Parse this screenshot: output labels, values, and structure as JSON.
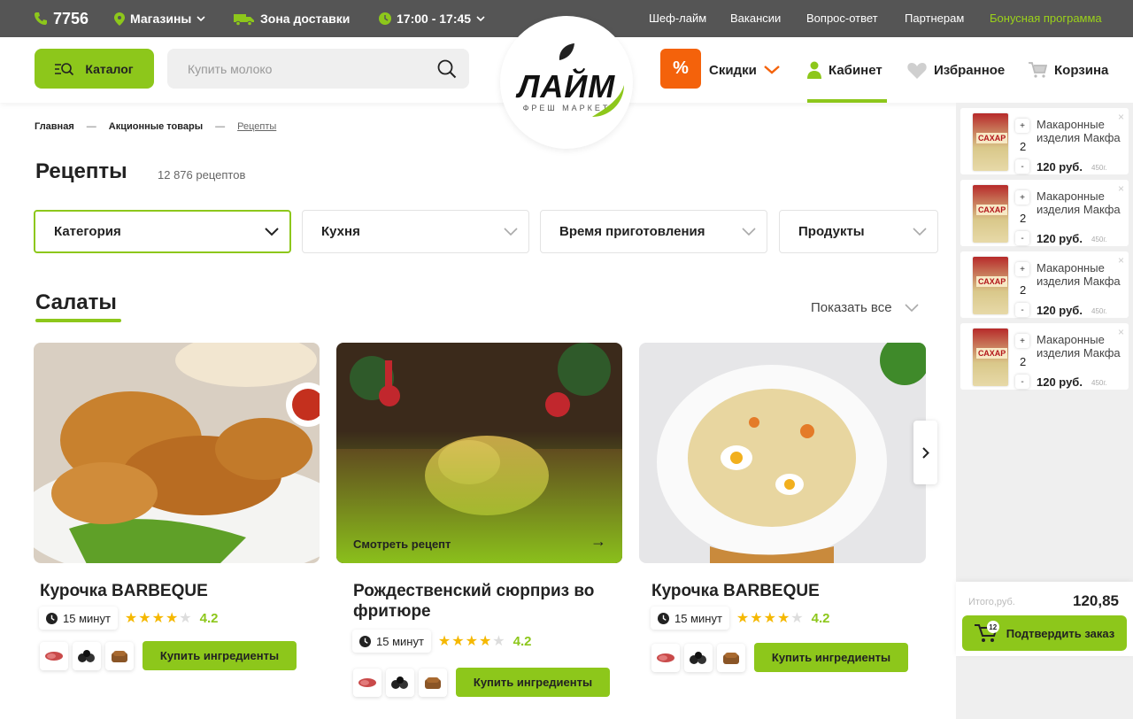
{
  "topbar": {
    "phone": "7756",
    "stores": "Магазины",
    "delivery": "Зона доставки",
    "time": "17:00 - 17:45",
    "links": [
      "Шеф-лайм",
      "Вакансии",
      "Вопрос-ответ",
      "Партнерам"
    ],
    "bonus": "Бонусная программа"
  },
  "header": {
    "catalog": "Каталог",
    "search_placeholder": "Купить молоко",
    "logo_main": "ЛАЙМ",
    "logo_sub": "ФРЕШ МАРКЕТ",
    "discount_symbol": "%",
    "discounts": "Скидки",
    "cabinet": "Кабинет",
    "favorites": "Избранное",
    "cart": "Корзина"
  },
  "breadcrumbs": {
    "home": "Главная",
    "promo": "Акционные товары",
    "current": "Рецепты",
    "sep": "—"
  },
  "page": {
    "title": "Рецепты",
    "count": "12 876 рецептов"
  },
  "filters": [
    "Категория",
    "Кухня",
    "Время приготовления",
    "Продукты"
  ],
  "section": {
    "title": "Салаты",
    "show_all": "Показать все"
  },
  "recipes": [
    {
      "title": "Курочка BARBEQUE",
      "time": "15 минут",
      "rating": "4.2",
      "buy": "Купить ингредиенты"
    },
    {
      "title": "Рождественский сюрприз во фритюре",
      "time": "15 минут",
      "rating": "4.2",
      "buy": "Купить ингредиенты",
      "see": "Смотреть рецепт"
    },
    {
      "title": "Курочка BARBEQUE",
      "time": "15 минут",
      "rating": "4.2",
      "buy": "Купить ингредиенты"
    }
  ],
  "cart": {
    "items": [
      {
        "name": "Макаронные изделия Макфа",
        "qty": "2",
        "price": "120 руб.",
        "weight": "450г.",
        "label": "САХАР"
      },
      {
        "name": "Макаронные изделия Макфа",
        "qty": "2",
        "price": "120 руб.",
        "weight": "450г.",
        "label": "САХАР"
      },
      {
        "name": "Макаронные изделия Макфа",
        "qty": "2",
        "price": "120 руб.",
        "weight": "450г.",
        "label": "САХАР"
      },
      {
        "name": "Макаронные изделия Макфа",
        "qty": "2",
        "price": "120 руб.",
        "weight": "450г.",
        "label": "САХАР"
      }
    ],
    "plus": "+",
    "minus": "-",
    "close": "×",
    "total_label": "Итого,руб.",
    "total": "120,85",
    "badge": "12",
    "confirm": "Подтвердить заказ"
  },
  "colors": {
    "accent": "#8dc71b",
    "discount": "#f4620b",
    "topbar": "#555555"
  }
}
